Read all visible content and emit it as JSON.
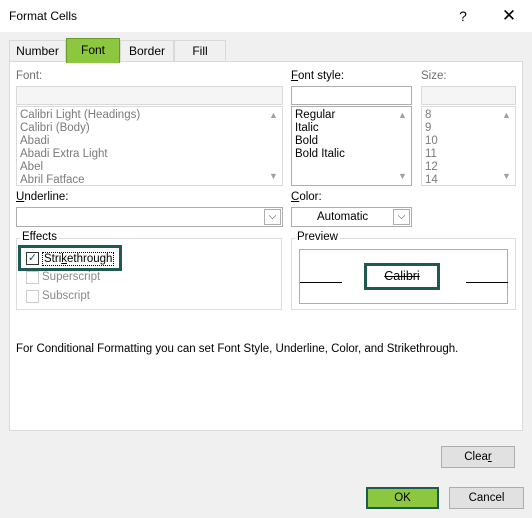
{
  "window": {
    "title": "Format Cells",
    "help_glyph": "?",
    "close_glyph": "✕"
  },
  "tabs": [
    {
      "label": "Number",
      "active": false
    },
    {
      "label": "Font",
      "active": true
    },
    {
      "label": "Border",
      "active": false
    },
    {
      "label": "Fill",
      "active": false
    }
  ],
  "font": {
    "label": "Font:",
    "value": "",
    "items": [
      "Calibri Light (Headings)",
      "Calibri (Body)",
      "Abadi",
      "Abadi Extra Light",
      "Abel",
      "Abril Fatface"
    ]
  },
  "font_style": {
    "label_pre": "",
    "label_u": "F",
    "label_post": "ont style:",
    "value": "",
    "items": [
      "Regular",
      "Italic",
      "Bold",
      "Bold Italic"
    ]
  },
  "size": {
    "label": "Size:",
    "value": "",
    "items": [
      "8",
      "9",
      "10",
      "11",
      "12",
      "14"
    ]
  },
  "underline": {
    "label_u": "U",
    "label_post": "nderline:",
    "value": ""
  },
  "color": {
    "label_u": "C",
    "label_post": "olor:",
    "value": "Automatic"
  },
  "effects": {
    "label": "Effects",
    "strikethrough": {
      "pre": "Stri",
      "u": "k",
      "post": "ethrough",
      "checked": true,
      "check_glyph": "✓"
    },
    "superscript": {
      "label": "Superscript",
      "checked": false
    },
    "subscript": {
      "label": "Subscript",
      "checked": false
    }
  },
  "preview": {
    "label": "Preview",
    "sample": "Calibri"
  },
  "info_text": "For Conditional Formatting you can set Font Style, Underline, Color, and Strikethrough.",
  "buttons": {
    "clear_pre": "Clea",
    "clear_u": "r",
    "ok": "OK",
    "cancel": "Cancel"
  },
  "icons": {
    "scroll_up": "▲",
    "scroll_down": "▼",
    "combo_arrow": "⌵"
  }
}
